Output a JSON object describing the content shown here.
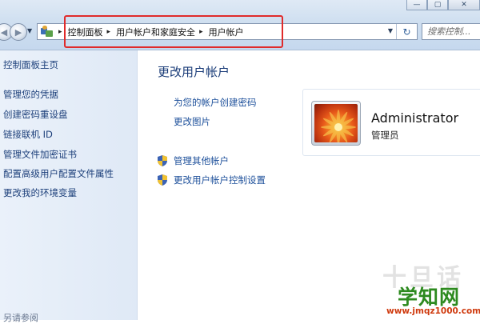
{
  "window": {
    "controls": [
      "—",
      "▢",
      "✕"
    ]
  },
  "nav": {
    "back": "◀",
    "forward": "▶",
    "dropdown": "▼"
  },
  "address": {
    "icon": "control-panel-icon",
    "separator": "▸",
    "crumbs": [
      "控制面板",
      "用户帐户和家庭安全",
      "用户帐户"
    ],
    "dropdown": "▼",
    "refresh": "↻"
  },
  "search": {
    "placeholder": "搜索控制..."
  },
  "highlight_color": "#e02b2b",
  "sidebar": {
    "home": "控制面板主页",
    "items": [
      {
        "label": "管理您的凭据"
      },
      {
        "label": "创建密码重设盘"
      },
      {
        "label": "链接联机 ID"
      },
      {
        "label": "管理文件加密证书"
      },
      {
        "label": "配置高级用户配置文件属性"
      },
      {
        "label": "更改我的环境变量"
      }
    ],
    "see_also": "另请参阅"
  },
  "main": {
    "title": "更改用户帐户",
    "tasks": [
      "为您的帐户创建密码",
      "更改图片"
    ],
    "shield_tasks": [
      "管理其他帐户",
      "更改用户帐户控制设置"
    ]
  },
  "user": {
    "name": "Administrator",
    "role": "管理员"
  },
  "watermark": {
    "ghost": "十旦话",
    "title": "学知网",
    "url": "www.jmqz1000.com"
  }
}
